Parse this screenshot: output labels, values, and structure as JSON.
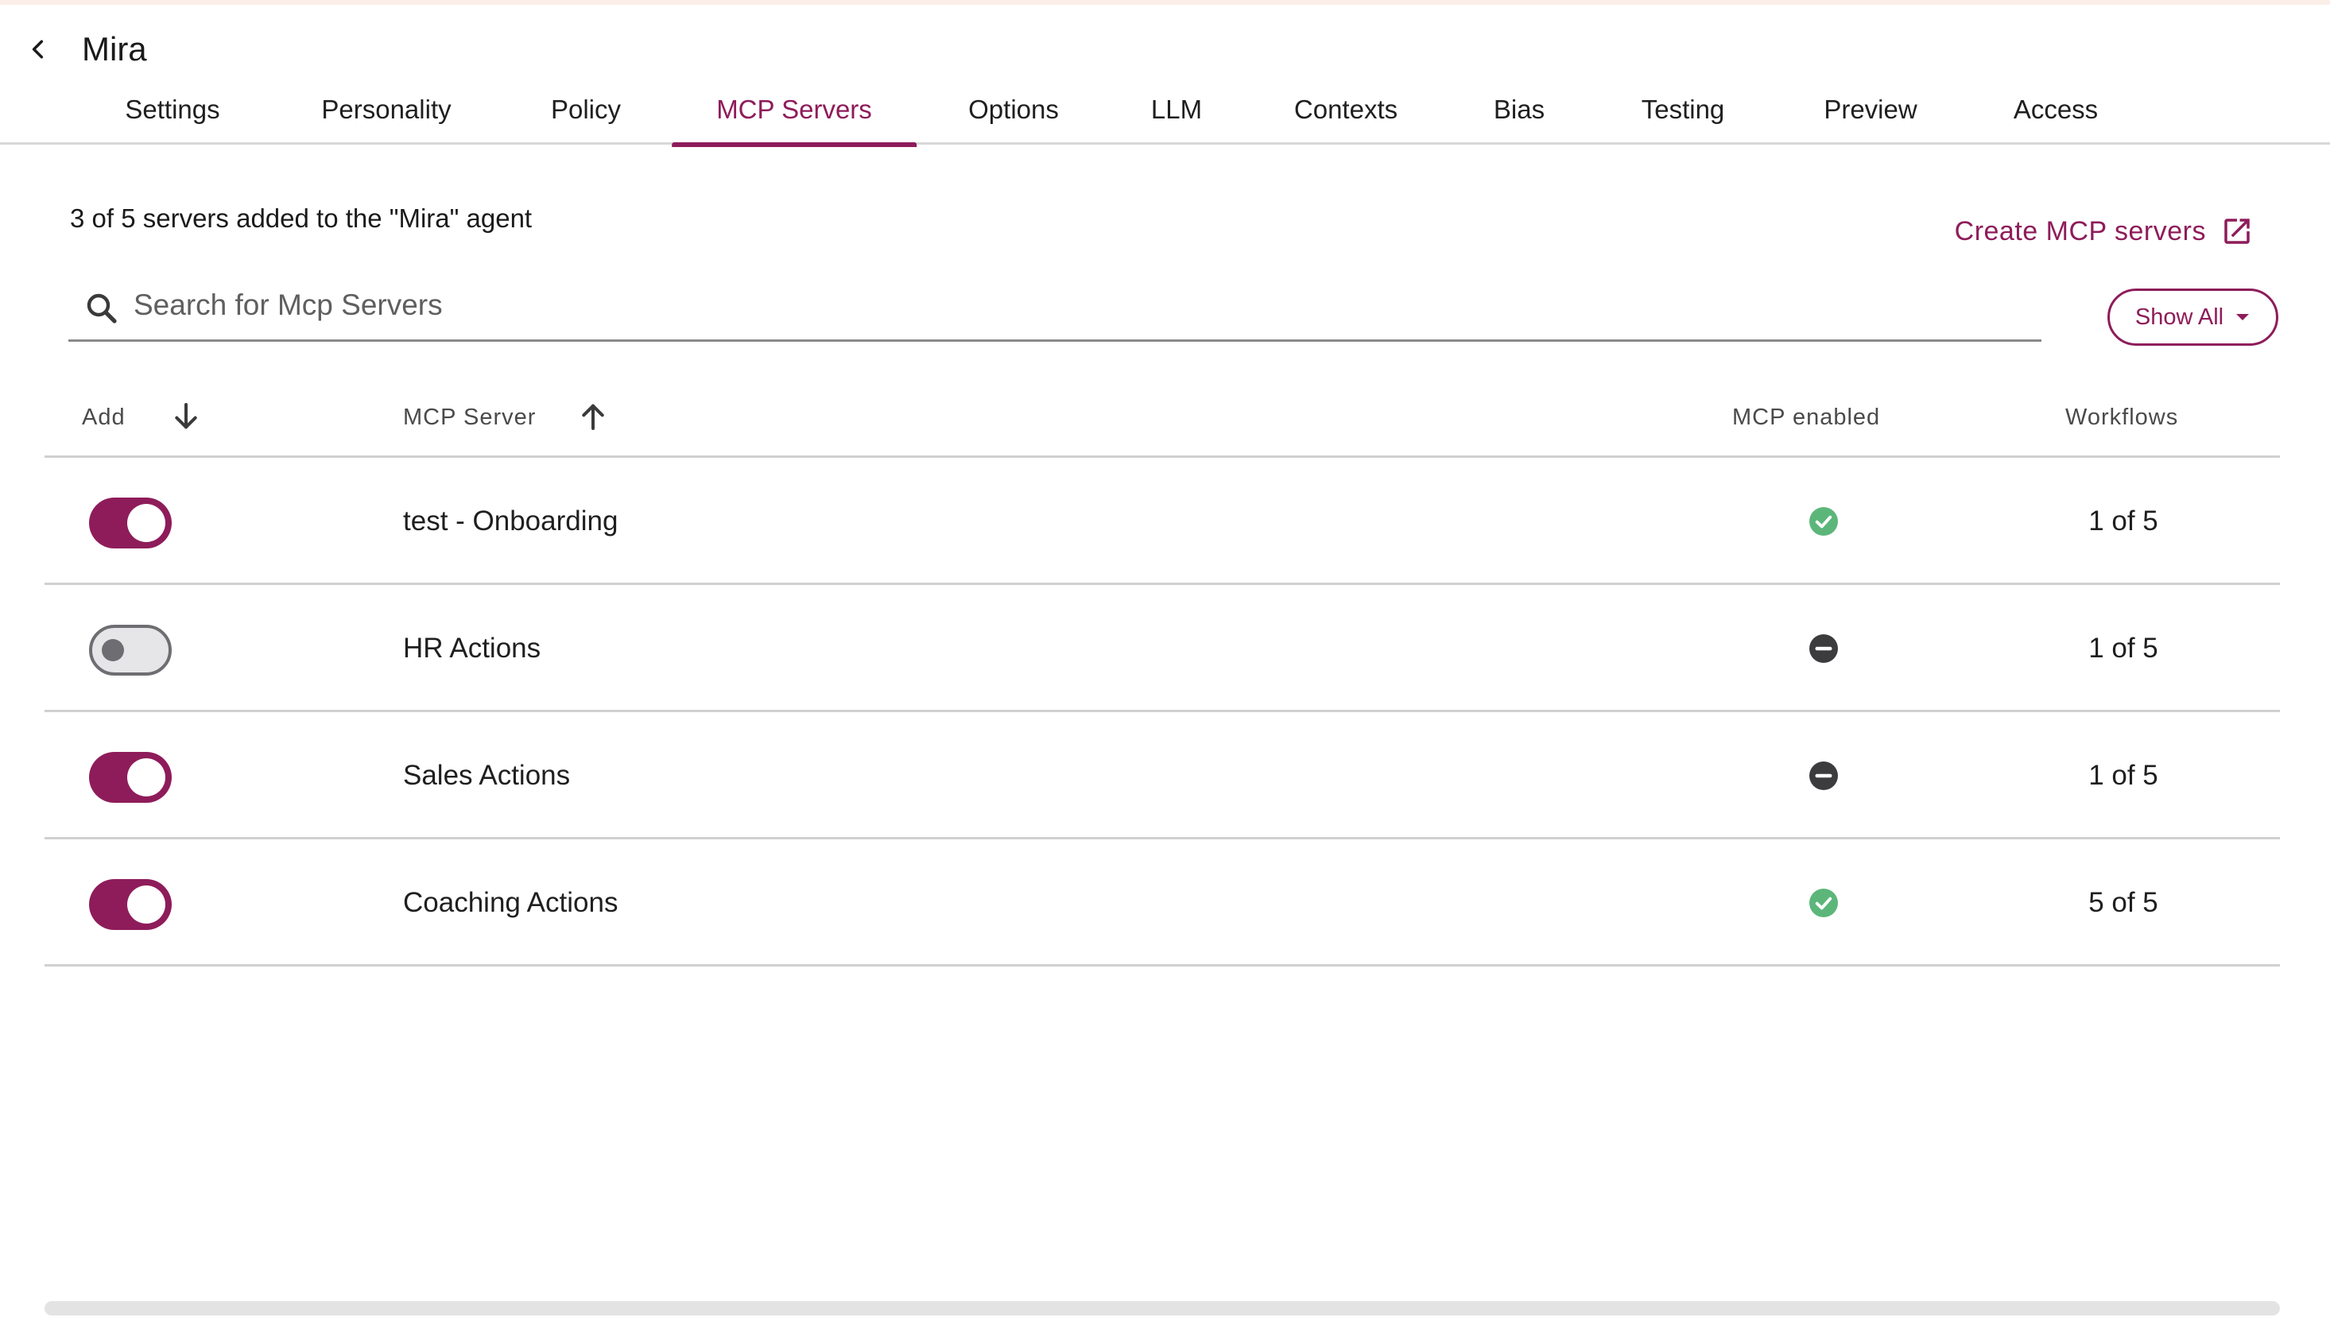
{
  "header": {
    "title": "Mira",
    "back_icon": "chevron-left-icon"
  },
  "tabs": [
    {
      "label": "Settings",
      "active": false
    },
    {
      "label": "Personality",
      "active": false
    },
    {
      "label": "Policy",
      "active": false
    },
    {
      "label": "MCP Servers",
      "active": true
    },
    {
      "label": "Options",
      "active": false
    },
    {
      "label": "LLM",
      "active": false
    },
    {
      "label": "Contexts",
      "active": false
    },
    {
      "label": "Bias",
      "active": false
    },
    {
      "label": "Testing",
      "active": false
    },
    {
      "label": "Preview",
      "active": false
    },
    {
      "label": "Access",
      "active": false
    }
  ],
  "summary": "3 of 5 servers added to the \"Mira\" agent",
  "create_link": {
    "label": "Create MCP servers",
    "icon": "open-in-new-icon"
  },
  "search": {
    "placeholder": "Search for Mcp Servers",
    "value": "",
    "icon": "search-icon"
  },
  "filter": {
    "label": "Show All",
    "icon": "caret-down-icon"
  },
  "table": {
    "columns": {
      "add": "Add",
      "server": "MCP Server",
      "enabled": "MCP enabled",
      "workflows": "Workflows"
    },
    "sort_icons": {
      "add": "arrow-down-icon",
      "server": "arrow-up-icon"
    },
    "rows": [
      {
        "added": true,
        "name": "test - Onboarding",
        "enabled": true,
        "workflows": "1 of 5"
      },
      {
        "added": false,
        "name": "HR Actions",
        "enabled": false,
        "workflows": "1 of 5"
      },
      {
        "added": true,
        "name": "Sales Actions",
        "enabled": false,
        "workflows": "1 of 5"
      },
      {
        "added": true,
        "name": "Coaching Actions",
        "enabled": true,
        "workflows": "5 of 5"
      }
    ]
  },
  "colors": {
    "accent": "#8e1c5a",
    "enabled_status": "#5cb67a",
    "disabled_status": "#3c3c3f",
    "divider": "#d0d0d0"
  }
}
